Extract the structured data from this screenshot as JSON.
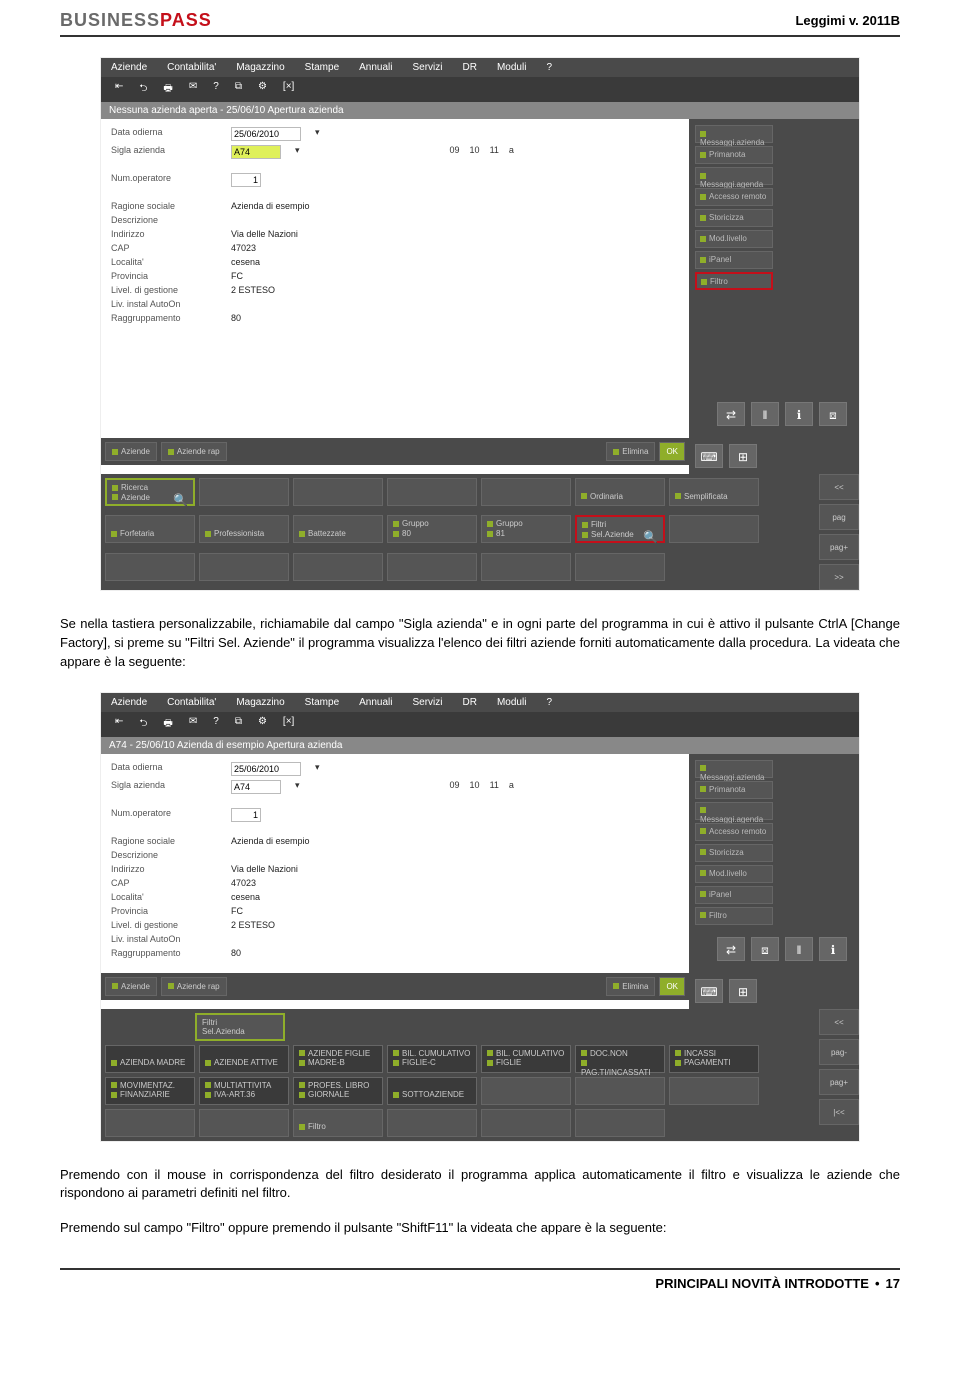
{
  "header": {
    "logo_part1": "BUSINESS",
    "logo_part2": "PASS",
    "version": "Leggimi v. 2011B"
  },
  "screenshot1": {
    "menu": [
      "Aziende",
      "Contabilita'",
      "Magazzino",
      "Stampe",
      "Annuali",
      "Servizi",
      "DR",
      "Moduli",
      "?"
    ],
    "toolbar_icons": [
      "⇤",
      "⮌",
      "🖶",
      "✉",
      "?",
      "⧉",
      "⚙",
      "[×]"
    ],
    "titlebar": "Nessuna azienda aperta - 25/06/10  Apertura azienda",
    "form": {
      "data_odierna_lbl": "Data odierna",
      "data_odierna_val": "25/06/2010",
      "sigla_lbl": "Sigla azienda",
      "sigla_val": "A74",
      "badges": [
        "09",
        "10",
        "11",
        "a"
      ],
      "num_op_lbl": "Num.operatore",
      "num_op_val": "1",
      "ragione_lbl": "Ragione sociale",
      "ragione_val": "Azienda di esempio",
      "descr_lbl": "Descrizione",
      "descr_val": "",
      "indirizzo_lbl": "Indirizzo",
      "indirizzo_val": "Via delle Nazioni",
      "cap_lbl": "CAP",
      "cap_val": "47023",
      "localita_lbl": "Localita'",
      "localita_val": "cesena",
      "provincia_lbl": "Provincia",
      "provincia_val": "FC",
      "livgest_lbl": "Livel. di gestione",
      "livgest_val": "2        ESTESO",
      "livinstal_lbl": "Liv. instal AutoOn",
      "livinstal_val": "",
      "raggr_lbl": "Raggruppamento",
      "raggr_val": "80"
    },
    "sidebuttons": [
      "Messaggi.azienda",
      "Primanota",
      "Messaggi.agenda",
      "Accesso remoto",
      "Storicizza",
      "Mod.livello",
      "iPanel",
      "Filtro"
    ],
    "sidehl_index": 7,
    "iconbar": [
      "⇄",
      "‖",
      "ℹ",
      "⧈"
    ],
    "iconbar2": [
      "⌨",
      "⊞"
    ],
    "bottom": {
      "aziende": "Aziende",
      "aziende_rap": "Aziende rap",
      "elimina": "Elimina",
      "ok": "OK"
    },
    "keypad_row1": [
      {
        "line1": "Ricerca",
        "line2": "Aziende",
        "icon": "🔍",
        "hl": "g"
      },
      {
        "line1": "",
        "line2": ""
      },
      {
        "line1": "",
        "line2": ""
      },
      {
        "line1": "",
        "line2": ""
      },
      {
        "line1": "",
        "line2": ""
      }
    ],
    "keypad_row2": [
      {
        "line1": "",
        "line2": "Ordinaria"
      },
      {
        "line1": "",
        "line2": "Semplificata"
      },
      {
        "line1": "",
        "line2": "Forfetaria"
      },
      {
        "line1": "",
        "line2": "Professionista"
      },
      {
        "line1": "",
        "line2": "Battezzate"
      }
    ],
    "keypad_row3": [
      {
        "line1": "Gruppo",
        "line2": "80"
      },
      {
        "line1": "Gruppo",
        "line2": "81"
      },
      {
        "line1": "Filtri",
        "line2": "Sel.Aziende",
        "icon": "🔍",
        "hl": "r"
      },
      {
        "line1": "",
        "line2": ""
      },
      {
        "line1": "",
        "line2": ""
      }
    ],
    "keypad_row4": [
      {
        "line1": "",
        "line2": ""
      },
      {
        "line1": "",
        "line2": ""
      },
      {
        "line1": "",
        "line2": ""
      },
      {
        "line1": "",
        "line2": ""
      },
      {
        "line1": "",
        "line2": ""
      }
    ],
    "nav": [
      "<<",
      "pag",
      "pag+",
      ">>"
    ]
  },
  "para1": "Se nella tastiera personalizzabile, richiamabile dal campo \"Sigla azienda\" e in ogni parte del programma in cui è attivo il pulsante CtrlA [Change Factory], si preme su \"Filtri Sel. Aziende\" il programma visualizza l'elenco dei filtri aziende forniti automaticamente dalla procedura.  La videata che appare è la seguente:",
  "screenshot2": {
    "menu": [
      "Aziende",
      "Contabilita'",
      "Magazzino",
      "Stampe",
      "Annuali",
      "Servizi",
      "DR",
      "Moduli",
      "?"
    ],
    "toolbar_icons": [
      "⇤",
      "⮌",
      "🖶",
      "✉",
      "?",
      "⧉",
      "⚙",
      "[×]"
    ],
    "titlebar": "A74 - 25/06/10  Azienda di esempio  Apertura azienda",
    "form": {
      "data_odierna_lbl": "Data odierna",
      "data_odierna_val": "25/06/2010",
      "sigla_lbl": "Sigla azienda",
      "sigla_val": "A74",
      "badges": [
        "09",
        "10",
        "11",
        "a"
      ],
      "num_op_lbl": "Num.operatore",
      "num_op_val": "1",
      "ragione_lbl": "Ragione sociale",
      "ragione_val": "Azienda di esempio",
      "descr_lbl": "Descrizione",
      "descr_val": "",
      "indirizzo_lbl": "Indirizzo",
      "indirizzo_val": "Via delle Nazioni",
      "cap_lbl": "CAP",
      "cap_val": "47023",
      "localita_lbl": "Localita'",
      "localita_val": "cesena",
      "provincia_lbl": "Provincia",
      "provincia_val": "FC",
      "livgest_lbl": "Livel. di gestione",
      "livgest_val": "2        ESTESO",
      "livinstal_lbl": "Liv. instal AutoOn",
      "livinstal_val": "",
      "raggr_lbl": "Raggruppamento",
      "raggr_val": "80"
    },
    "sidebuttons": [
      "Messaggi.azienda",
      "Primanota",
      "Messaggi.agenda",
      "Accesso remoto",
      "Storicizza",
      "Mod.livello",
      "iPanel",
      "Filtro"
    ],
    "iconbar": [
      "⇄",
      "⧈",
      "‖",
      "ℹ"
    ],
    "iconbar2": [
      "⌨",
      "⊞"
    ],
    "bottom": {
      "aziende": "Aziende",
      "aziende_rap": "Aziende rap",
      "elimina": "Elimina",
      "ok": "OK"
    },
    "keypad_top": {
      "line1": "Filtri",
      "line2": "Sel.Azienda",
      "hl": "g"
    },
    "keypad_row1": [
      {
        "line1": "",
        "line2": "AZIENDA MADRE",
        "dark": true
      },
      {
        "line1": "",
        "line2": "AZIENDE ATTIVE",
        "dark": true
      },
      {
        "line1": "AZIENDE FIGLIE",
        "line2": "MADRE-B",
        "dark": true
      },
      {
        "line1": "BIL. CUMULATIVO",
        "line2": "FIGLIE-C",
        "dark": true
      },
      {
        "line1": "BIL. CUMULATIVO",
        "line2": "FIGLIE",
        "dark": true
      }
    ],
    "keypad_row2": [
      {
        "line1": "DOC.NON",
        "line2": "PAG.TI/INCASSATI",
        "dark": true
      },
      {
        "line1": "INCASSI",
        "line2": "PAGAMENTI",
        "dark": true
      },
      {
        "line1": "MOVIMENTAZ.",
        "line2": "FINANZIARIE",
        "dark": true
      },
      {
        "line1": "MULTIATTIVITA",
        "line2": "IVA-ART.36",
        "dark": true
      },
      {
        "line1": "PROFES.  LIBRO",
        "line2": "GIORNALE",
        "dark": true
      }
    ],
    "keypad_row3": [
      {
        "line1": "",
        "line2": "SOTTOAZIENDE",
        "dark": true
      },
      {
        "line1": "",
        "line2": ""
      },
      {
        "line1": "",
        "line2": ""
      },
      {
        "line1": "",
        "line2": ""
      },
      {
        "line1": "",
        "line2": ""
      }
    ],
    "keypad_row4": [
      {
        "line1": "",
        "line2": ""
      },
      {
        "line1": "",
        "line2": "Filtro"
      },
      {
        "line1": "",
        "line2": ""
      },
      {
        "line1": "",
        "line2": ""
      },
      {
        "line1": "",
        "line2": ""
      }
    ],
    "nav": [
      "<<",
      "pag-",
      "pag+",
      "|<<"
    ]
  },
  "para2": "Premendo con il mouse in corrispondenza del filtro desiderato il programma applica automaticamente il filtro e visualizza le aziende che rispondono ai parametri definiti nel filtro.",
  "para3": "Premendo sul campo \"Filtro\" oppure premendo il pulsante \"ShiftF11\" la videata che appare è la seguente:",
  "footer": {
    "text": "PRINCIPALI NOVITÀ INTRODOTTE",
    "bullet": "•",
    "page": "17"
  }
}
